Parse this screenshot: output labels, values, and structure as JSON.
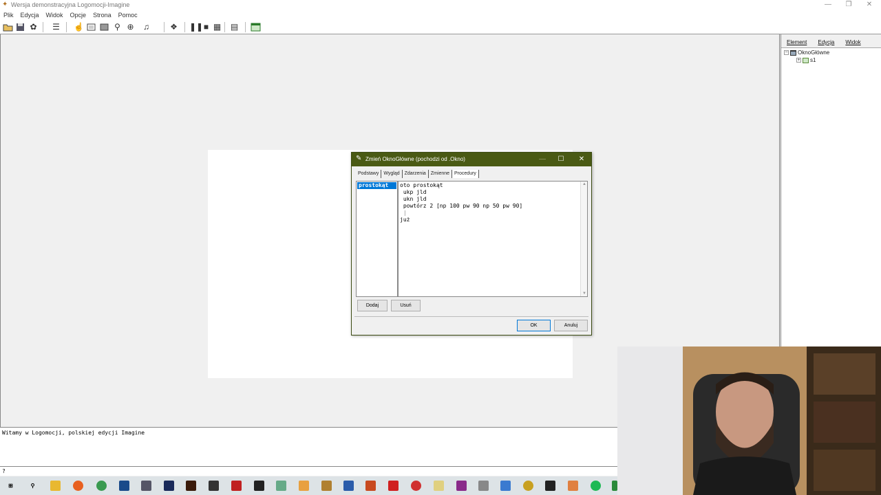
{
  "window": {
    "title": "Wersja demonstracyjna Logomocji-Imagine",
    "minimize": "—",
    "restore": "❐",
    "close": "✕"
  },
  "menu": [
    "Plik",
    "Edycja",
    "Widok",
    "Opcje",
    "Strona",
    "Pomoc"
  ],
  "right_panel": {
    "menu": [
      "Element",
      "Edycja",
      "Widok"
    ],
    "tree": [
      {
        "toggle": "−",
        "label": "OknoGłówne"
      },
      {
        "toggle": "+",
        "label": "s1"
      }
    ]
  },
  "dialog": {
    "title": "Zmień OknoGłówne (pochodzi od .Okno)",
    "tabs": [
      "Podstawy",
      "Wygląd",
      "Zdarzenia",
      "Zmienne",
      "Procedury"
    ],
    "active_tab": "Procedury",
    "procedures": [
      "prostokąt"
    ],
    "code_lines": [
      "oto prostokąt",
      " ukp jld",
      " ukn jld",
      " powtórz 2 [np 100 pw 90 np 50 pw 90]",
      " |",
      "już"
    ],
    "add_button": "Dodaj",
    "remove_button": "Usuń",
    "ok_button": "OK",
    "cancel_button": "Anuluj"
  },
  "messages": {
    "welcome": "Witamy w Logomocji, polskiej edycji Imagine",
    "prompt": "?"
  },
  "colors": {
    "dialog_title": "#4a5a14",
    "selection": "#0078d7",
    "taskbar": "#dde3e6"
  }
}
